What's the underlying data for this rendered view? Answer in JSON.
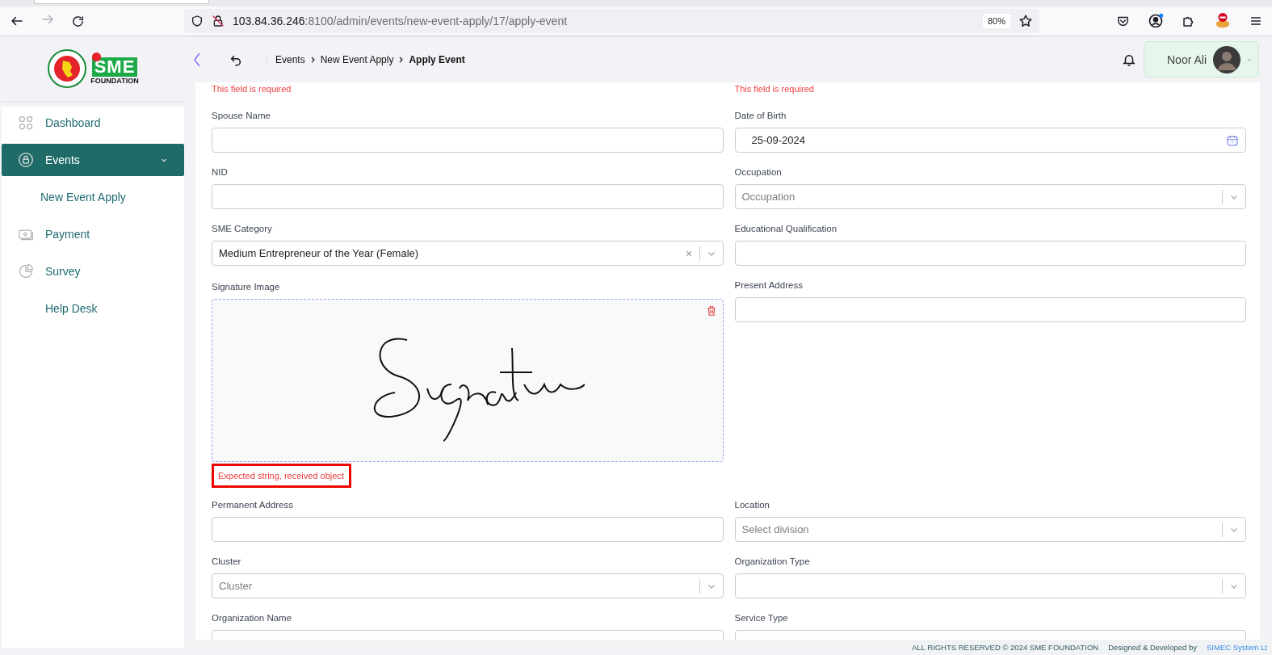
{
  "browser": {
    "url_host": "103.84.36.246",
    "url_rest": ":8100/admin/events/new-event-apply/17/apply-event",
    "zoom": "80%"
  },
  "logo": {
    "mark": "SME",
    "caption": "FOUNDATION"
  },
  "sidebar": {
    "items": [
      {
        "label": "Dashboard",
        "selected": false
      },
      {
        "label": "Events",
        "selected": true,
        "expanded": true,
        "children": [
          {
            "label": "New Event Apply",
            "selected": false
          }
        ]
      },
      {
        "label": "Payment",
        "selected": false
      },
      {
        "label": "Survey",
        "selected": false
      },
      {
        "label": "Help Desk",
        "selected": false
      }
    ]
  },
  "breadcrumbs": [
    {
      "label": "Events",
      "current": false
    },
    {
      "label": "New Event Apply",
      "current": false
    },
    {
      "label": "Apply Event",
      "current": true
    }
  ],
  "user": {
    "name": "Noor Ali"
  },
  "form": {
    "rows": [
      {
        "left": {
          "kind": "error",
          "text": "This field is required"
        },
        "right": {
          "kind": "error",
          "text": "This field is required"
        }
      },
      {
        "left": {
          "kind": "text",
          "label": "Spouse Name"
        },
        "right": {
          "kind": "date",
          "label": "Date of Birth",
          "value": "25-09-2024"
        }
      },
      {
        "left": {
          "kind": "text",
          "label": "NID"
        },
        "right": {
          "kind": "select",
          "label": "Occupation",
          "placeholder": "Occupation"
        }
      },
      {
        "left": {
          "kind": "select",
          "label": "SME Category",
          "value": "Medium Entrepreneur of the Year (Female)",
          "clearable": true
        },
        "right": {
          "kind": "text",
          "label": "Educational Qualification"
        }
      },
      {
        "left": {
          "kind": "signature",
          "label": "Signature Image",
          "error": "Expected string, received object",
          "highlighted": true
        },
        "right": {
          "kind": "text",
          "label": "Present Address"
        }
      },
      {
        "left": {
          "kind": "text",
          "label": "Permanent Address"
        },
        "right": {
          "kind": "select",
          "label": "Location",
          "placeholder": "Select division"
        }
      },
      {
        "left": {
          "kind": "select",
          "label": "Cluster",
          "placeholder": "Cluster"
        },
        "right": {
          "kind": "select",
          "label": "Organization Type"
        }
      },
      {
        "left": {
          "kind": "text",
          "label": "Organization Name"
        },
        "right": {
          "kind": "text",
          "label": "Service Type"
        }
      }
    ]
  },
  "footer": {
    "text": "ALL RIGHTS RESERVED © 2024 SME FOUNDATION",
    "credit": "Designed & Developed by",
    "link": "SIMEC System Lt"
  }
}
